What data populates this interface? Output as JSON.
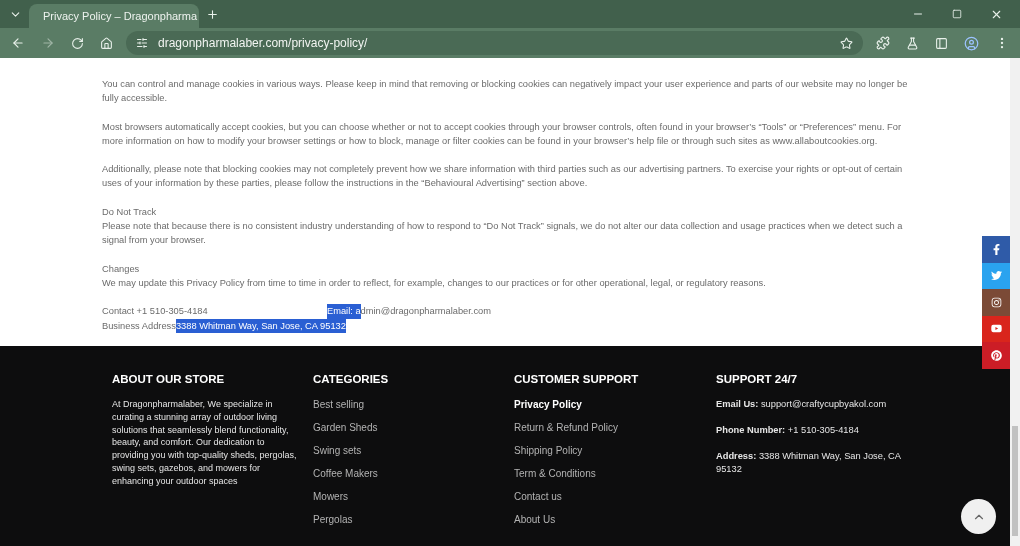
{
  "browser": {
    "tabs": [
      {
        "title": "Privacy Policy – Dragonpharma",
        "selected": true
      }
    ],
    "url": "dragonpharmalaber.com/privacy-policy/"
  },
  "policy": {
    "blocks": [
      {
        "kind": "paragraph",
        "text": "You can control and manage cookies in various ways. Please keep in mind that removing or blocking cookies can negatively impact your user experience and parts of our website may no longer be fully accessible."
      },
      {
        "kind": "paragraph",
        "text": "Most browsers automatically accept cookies, but you can choose whether or not to accept cookies through your browser controls, often found in your browser’s “Tools” or “Preferences” menu. For more information on how to modify your browser settings or how to block, manage or filter cookies can be found in your browser’s help file or through such sites as www.allaboutcookies.org."
      },
      {
        "kind": "paragraph",
        "text": "Additionally, please note that blocking cookies may not completely prevent how we share information with third parties such as our advertising partners. To exercise your rights or opt-out of certain uses of your information by these parties, please follow the instructions in the “Behavioural Advertising” section above."
      },
      {
        "kind": "section",
        "heading": "Do Not Track",
        "text": "Please note that because there is no consistent industry understanding of how to respond to “Do Not Track” signals, we do not alter our data collection and usage practices when we detect such a signal from your browser."
      },
      {
        "kind": "section",
        "heading": "Changes",
        "text": "We may update this Privacy Policy from time to time in order to reflect, for example, changes to our practices or for other operational, legal, or regulatory reasons."
      }
    ],
    "contact": {
      "phone": "Contact +1 510-305-4184",
      "email": [
        {
          "text": "Email: a",
          "highlighted": true
        },
        {
          "text": "dmin@dragonpharmalaber.com",
          "highlighted": false
        }
      ],
      "address": [
        {
          "text": "Business Address",
          "highlighted": false
        },
        {
          "text": "3388 Whitman Way, San Jose, CA 95132",
          "highlighted": true
        }
      ]
    }
  },
  "social": [
    {
      "kind": "facebook",
      "color": "#2f5ba8"
    },
    {
      "kind": "twitter",
      "color": "#2aa3ef"
    },
    {
      "kind": "instagram",
      "color": "#7b4a36"
    },
    {
      "kind": "youtube",
      "color": "#d9251c"
    },
    {
      "kind": "pinterest",
      "color": "#cc1d26"
    }
  ],
  "footer": {
    "about": {
      "title": "ABOUT OUR STORE",
      "text": "At Dragonpharmalaber, We specialize in curating a stunning array of outdoor living solutions that seamlessly blend functionality, beauty, and comfort. Our dedication to providing you with top-quality sheds, pergolas, swing sets, gazebos, and mowers for enhancing your outdoor spaces"
    },
    "categories": {
      "title": "CATEGORIES",
      "links": [
        "Best selling",
        "Garden Sheds",
        "Swing sets",
        "Coffee Makers",
        "Mowers",
        "Pergolas"
      ]
    },
    "customer_support": {
      "title": "CUSTOMER SUPPORT",
      "links": [
        {
          "label": "Privacy Policy",
          "selected": true
        },
        {
          "label": "Return & Refund Policy",
          "selected": false
        },
        {
          "label": "Shipping Policy",
          "selected": false
        },
        {
          "label": "Term & Conditions",
          "selected": false
        },
        {
          "label": "Contact us",
          "selected": false
        },
        {
          "label": "About Us",
          "selected": false
        }
      ]
    },
    "support": {
      "title": "SUPPORT 24/7",
      "items": [
        "**Email Us:** support@craftycupbyakol.com",
        "**Phone Number:** +1 510-305-4184",
        "**Address:** 3388 Whitman Way, San Jose, CA 95132"
      ]
    }
  }
}
